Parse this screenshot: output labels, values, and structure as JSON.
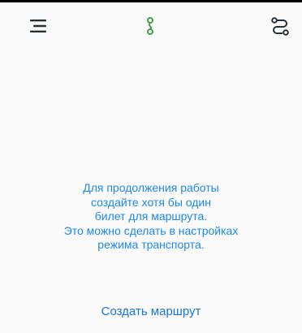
{
  "app_bar": {
    "menu_icon": "menu-icon",
    "logo_icon": "route-pin-icon",
    "routes_icon": "route-icon",
    "logo_color": "#43a047"
  },
  "empty_state": {
    "lines": [
      "Для продолжения работы",
      "создайте хотя бы один",
      "билет для маршрута.",
      "Это можно сделать в настройках",
      "режима транспорта."
    ],
    "text_color": "#1e88e5"
  },
  "actions": {
    "create_route_label": "Создать маршрут",
    "link_color": "#1976d2"
  }
}
